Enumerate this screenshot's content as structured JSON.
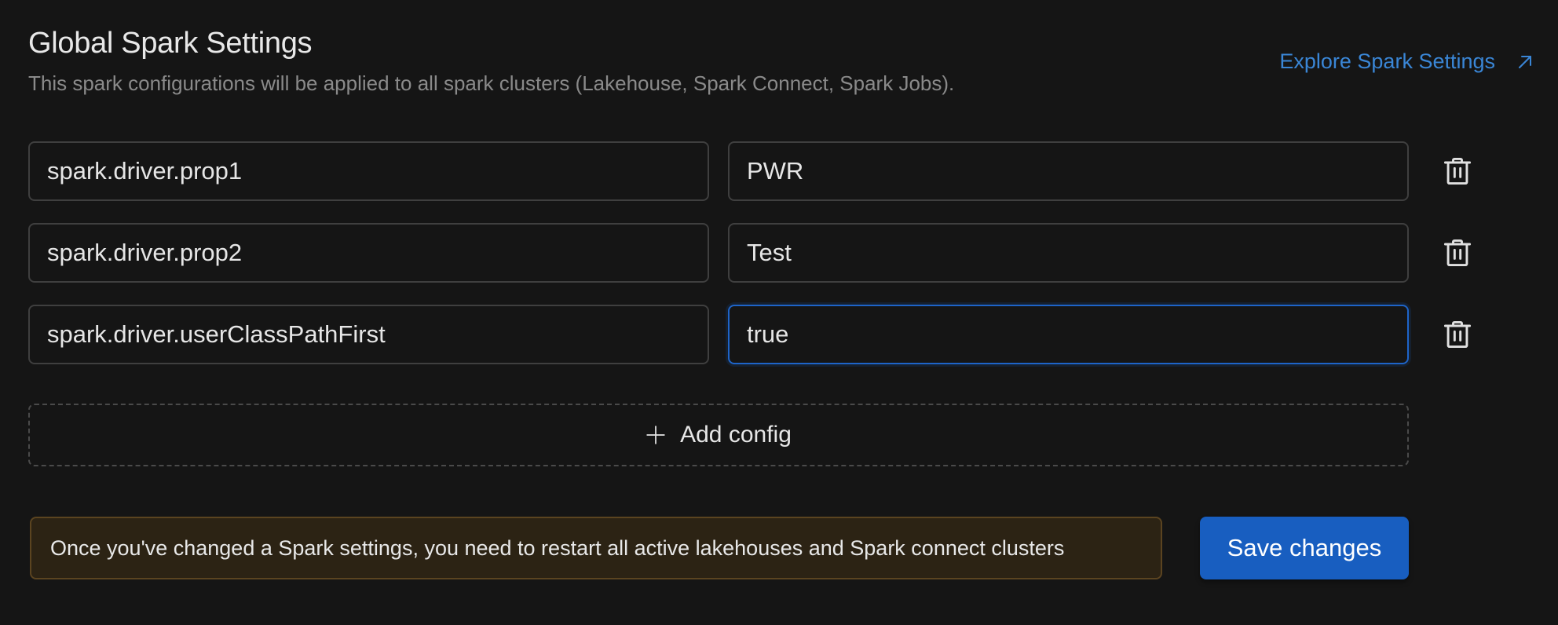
{
  "header": {
    "title": "Global Spark Settings",
    "subtitle": "This spark configurations will be applied to all spark clusters (Lakehouse, Spark Connect, Spark Jobs).",
    "explore_link": "Explore Spark Settings",
    "explore_icon": "arrow-up-right-icon"
  },
  "configs": [
    {
      "key": "spark.driver.prop1",
      "value": "PWR",
      "focused": false
    },
    {
      "key": "spark.driver.prop2",
      "value": "Test",
      "focused": false
    },
    {
      "key": "spark.driver.userClassPathFirst",
      "value": "true",
      "focused": true
    }
  ],
  "add_config": {
    "label": "Add config",
    "icon": "plus-icon"
  },
  "notice": {
    "text": "Once you've changed a Spark settings, you need to restart all active lakehouses and Spark connect clusters"
  },
  "footer": {
    "save_label": "Save changes"
  },
  "colors": {
    "background": "#151515",
    "accent": "#185ec0",
    "link": "#3a86d6",
    "notice_bg": "#2c2314",
    "notice_border": "#5b4420"
  }
}
